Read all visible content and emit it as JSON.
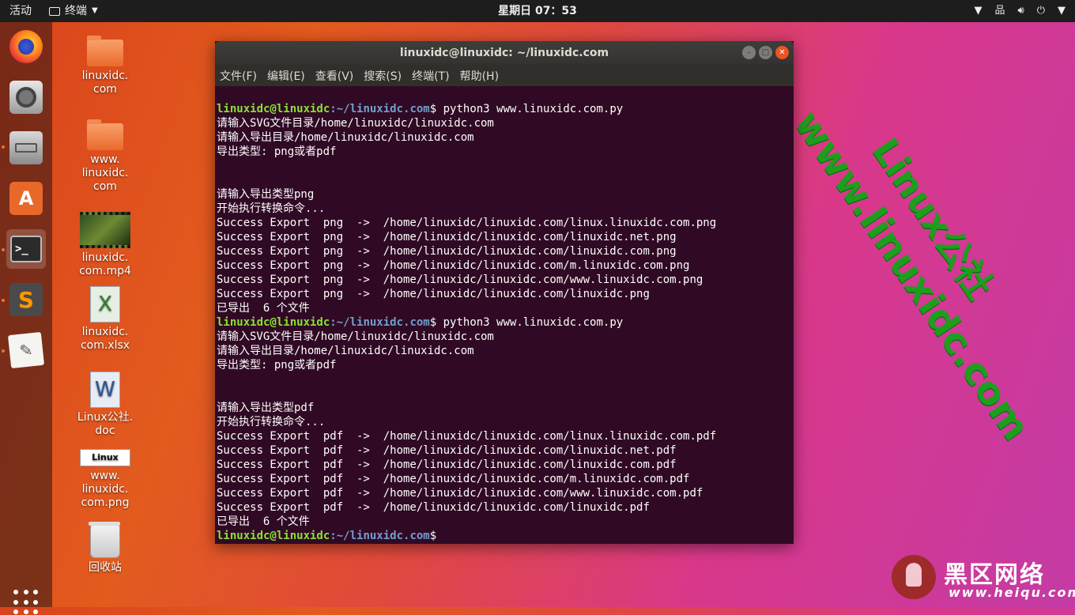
{
  "topbar": {
    "activities": "活动",
    "app_name": "终端",
    "clock": "星期日 07：53",
    "right_icons": [
      "dropdown-icon",
      "network-icon",
      "volume-icon",
      "power-icon",
      "caret-icon"
    ]
  },
  "dock": {
    "items": [
      "firefox",
      "camera",
      "files",
      "software-center",
      "terminal",
      "sublime-text",
      "text-editor"
    ],
    "show_apps": "show-applications"
  },
  "desktop": {
    "icons": [
      {
        "label": "linuxidc.\ncom",
        "type": "folder"
      },
      {
        "label": "www.\nlinuxidc.\ncom",
        "type": "folder"
      },
      {
        "label": "linuxidc.\ncom.mp4",
        "type": "video"
      },
      {
        "label": "linuxidc.\ncom.xlsx",
        "type": "spreadsheet"
      },
      {
        "label": "Linux公社.\ndoc",
        "type": "document"
      },
      {
        "label": "www.\nlinuxidc.\ncom.png",
        "type": "image"
      },
      {
        "label": "回收站",
        "type": "trash"
      }
    ]
  },
  "terminal": {
    "title": "linuxidc@linuxidc: ~/linuxidc.com",
    "menu": [
      "文件(F)",
      "编辑(E)",
      "查看(V)",
      "搜索(S)",
      "终端(T)",
      "帮助(H)"
    ],
    "prompt_user": "linuxidc@linuxidc",
    "prompt_path": ":~/linuxidc.com",
    "prompt_symbol": "$",
    "command": " python3 www.linuxidc.com.py",
    "run1": [
      "请输入SVG文件目录/home/linuxidc/linuxidc.com",
      "请输入导出目录/home/linuxidc/linuxidc.com",
      "导出类型: png或者pdf",
      "",
      "",
      "请输入导出类型png",
      "开始执行转换命令...",
      "Success Export  png  ->  /home/linuxidc/linuxidc.com/linux.linuxidc.com.png",
      "Success Export  png  ->  /home/linuxidc/linuxidc.com/linuxidc.net.png",
      "Success Export  png  ->  /home/linuxidc/linuxidc.com/linuxidc.com.png",
      "Success Export  png  ->  /home/linuxidc/linuxidc.com/m.linuxidc.com.png",
      "Success Export  png  ->  /home/linuxidc/linuxidc.com/www.linuxidc.com.png",
      "Success Export  png  ->  /home/linuxidc/linuxidc.com/linuxidc.png",
      "已导出  6 个文件"
    ],
    "run2": [
      "请输入SVG文件目录/home/linuxidc/linuxidc.com",
      "请输入导出目录/home/linuxidc/linuxidc.com",
      "导出类型: png或者pdf",
      "",
      "",
      "请输入导出类型pdf",
      "开始执行转换命令...",
      "Success Export  pdf  ->  /home/linuxidc/linuxidc.com/linux.linuxidc.com.pdf",
      "Success Export  pdf  ->  /home/linuxidc/linuxidc.com/linuxidc.net.pdf",
      "Success Export  pdf  ->  /home/linuxidc/linuxidc.com/linuxidc.com.pdf",
      "Success Export  pdf  ->  /home/linuxidc/linuxidc.com/m.linuxidc.com.pdf",
      "Success Export  pdf  ->  /home/linuxidc/linuxidc.com/www.linuxidc.com.pdf",
      "Success Export  pdf  ->  /home/linuxidc/linuxidc.com/linuxidc.pdf",
      "已导出  6 个文件"
    ]
  },
  "watermarks": {
    "linux_site": "Linux公社",
    "linux_url": "www.linuxidc.com",
    "heiqu_name": "黑区网络",
    "heiqu_url": "www.heiqu.com"
  }
}
